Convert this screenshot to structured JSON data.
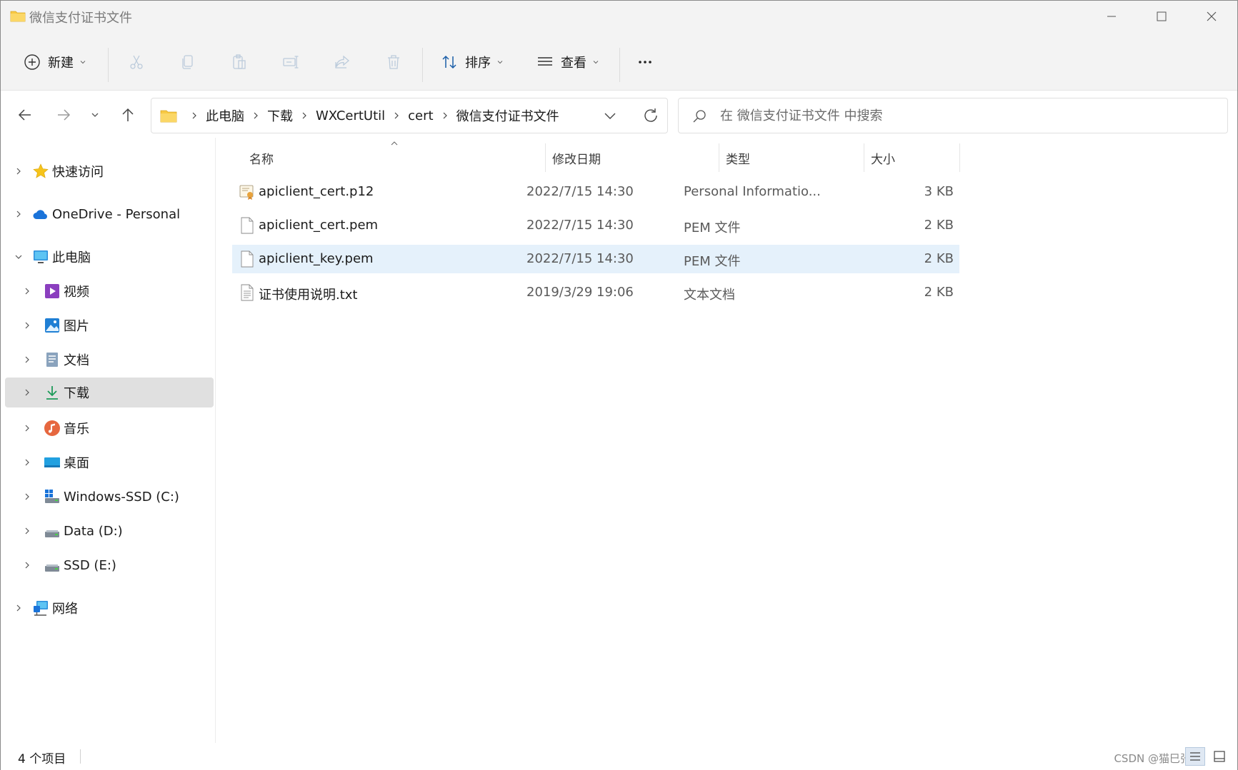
{
  "window": {
    "title": "微信支付证书文件"
  },
  "toolbar": {
    "new_label": "新建",
    "sort_label": "排序",
    "view_label": "查看",
    "more_label": "···"
  },
  "address": {
    "crumbs": [
      "此电脑",
      "下载",
      "WXCertUtil",
      "cert",
      "微信支付证书文件"
    ]
  },
  "search": {
    "placeholder": "在 微信支付证书文件 中搜索"
  },
  "sidebar": {
    "items": [
      {
        "label": "快速访问",
        "icon": "star-icon"
      },
      {
        "label": "OneDrive - Personal",
        "icon": "cloud-icon"
      },
      {
        "label": "此电脑",
        "icon": "computer-icon"
      },
      {
        "label": "视频",
        "icon": "video-icon"
      },
      {
        "label": "图片",
        "icon": "picture-icon"
      },
      {
        "label": "文档",
        "icon": "document-icon"
      },
      {
        "label": "下载",
        "icon": "download-icon"
      },
      {
        "label": "音乐",
        "icon": "music-icon"
      },
      {
        "label": "桌面",
        "icon": "desktop-icon"
      },
      {
        "label": "Windows-SSD (C:)",
        "icon": "windows-drive-icon"
      },
      {
        "label": "Data (D:)",
        "icon": "drive-icon"
      },
      {
        "label": "SSD (E:)",
        "icon": "drive-icon"
      },
      {
        "label": "网络",
        "icon": "network-icon"
      }
    ],
    "selected": "下载"
  },
  "columns": {
    "name": "名称",
    "modified": "修改日期",
    "type": "类型",
    "size": "大小"
  },
  "files": [
    {
      "name": "apiclient_cert.p12",
      "modified": "2022/7/15 14:30",
      "type": "Personal Informatio...",
      "size": "3 KB",
      "icon": "certificate-file-icon"
    },
    {
      "name": "apiclient_cert.pem",
      "modified": "2022/7/15 14:30",
      "type": "PEM 文件",
      "size": "2 KB",
      "icon": "blank-file-icon"
    },
    {
      "name": "apiclient_key.pem",
      "modified": "2022/7/15 14:30",
      "type": "PEM 文件",
      "size": "2 KB",
      "icon": "blank-file-icon"
    },
    {
      "name": "证书使用说明.txt",
      "modified": "2019/3/29 19:06",
      "type": "文本文档",
      "size": "2 KB",
      "icon": "text-file-icon"
    }
  ],
  "selected_file": "apiclient_key.pem",
  "status": {
    "item_count": "4 个项目",
    "watermark": "CSDN @猫巳张鲁"
  },
  "colors": {
    "accent": "#0067c0",
    "selection": "#e5f1fb",
    "sidebar_selected": "#e0e0e0",
    "folder": "#f8c944"
  }
}
